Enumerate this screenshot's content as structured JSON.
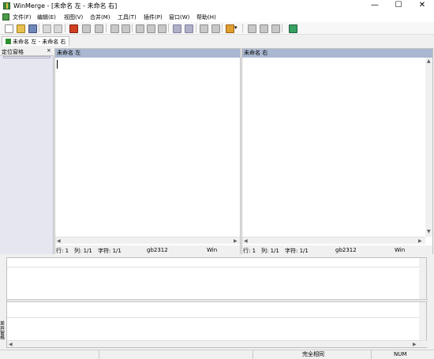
{
  "window": {
    "title": "WinMerge - [未命名 左 - 未命名 右]",
    "minimize_glyph": "—",
    "maximize_glyph": "☐",
    "close_glyph": "✕"
  },
  "menu": [
    {
      "label": "文件(F)"
    },
    {
      "label": "编辑(E)"
    },
    {
      "label": "视图(V)"
    },
    {
      "label": "合并(M)"
    },
    {
      "label": "工具(T)"
    },
    {
      "label": "插件(P)"
    },
    {
      "label": "窗口(W)"
    },
    {
      "label": "帮助(H)"
    }
  ],
  "toolbar": {
    "icons": [
      "new-icon",
      "open-icon",
      "save-icon",
      "undo-icon",
      "redo-icon",
      "options-icon",
      "refresh-icon",
      "first-diff-icon",
      "prev-diff-icon",
      "next-diff-icon",
      "last-diff-icon",
      "current-diff-icon",
      "copy-right-icon",
      "copy-left-icon",
      "copy-right-advance-icon",
      "copy-left-advance-icon",
      "all-right-icon",
      "all-left-icon",
      "filter-icon",
      "dropdown-icon",
      "open-right-icon",
      "open-left-icon",
      "open-both-icon",
      "compare-icon",
      "sync-icon"
    ],
    "dropdown_glyph": "▾"
  },
  "tab": {
    "label": "未命名 左 - 未命名 右"
  },
  "location_pane": {
    "title": "定位窗格",
    "close_glyph": "×"
  },
  "left_pane": {
    "title": "未命名 左",
    "status": {
      "line": "行: 1",
      "col": "列: 1/1",
      "char": "字符: 1/1",
      "encoding": "gb2312",
      "eol": "Win"
    }
  },
  "right_pane": {
    "title": "未命名 右",
    "status": {
      "line": "行: 1",
      "col": "列: 1/1",
      "char": "字符: 1/1",
      "encoding": "gb2312",
      "eol": "Win"
    }
  },
  "detail_pane": {
    "side_label": "差异窗格"
  },
  "statusbar": {
    "result": "完全相同",
    "num": "NUM"
  },
  "colors": {
    "pane_header": "#a9b8d0",
    "location_bg": "#e6e6f0"
  }
}
